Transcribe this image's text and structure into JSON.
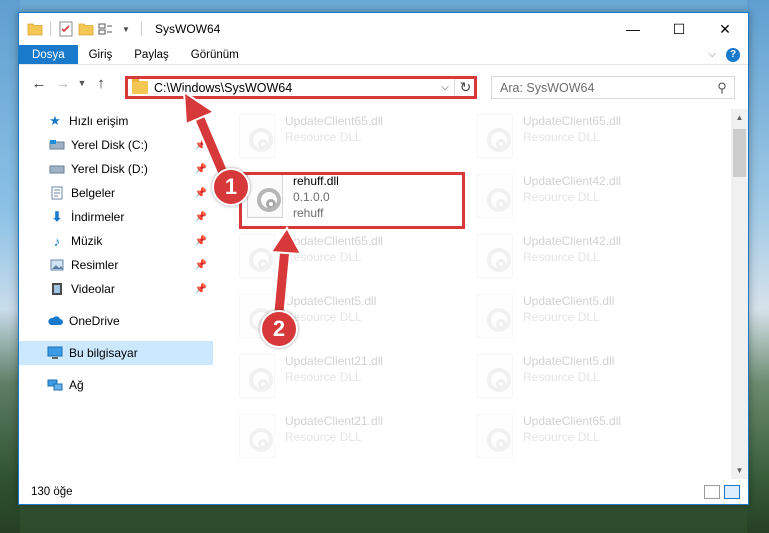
{
  "window": {
    "title": "SysWOW64",
    "controls": {
      "minimize": "—",
      "maximize": "☐",
      "close": "✕"
    }
  },
  "ribbon": {
    "tabs": [
      {
        "label": "Dosya",
        "active": true
      },
      {
        "label": "Giriş",
        "active": false
      },
      {
        "label": "Paylaş",
        "active": false
      },
      {
        "label": "Görünüm",
        "active": false
      }
    ]
  },
  "navigation": {
    "address": "C:\\Windows\\SysWOW64",
    "search_placeholder": "Ara: SysWOW64"
  },
  "sidebar": {
    "quick_access": "Hızlı erişim",
    "items": [
      {
        "label": "Yerel Disk (C:)",
        "icon": "drive-icon"
      },
      {
        "label": "Yerel Disk (D:)",
        "icon": "drive-icon"
      },
      {
        "label": "Belgeler",
        "icon": "documents-icon"
      },
      {
        "label": "İndirmeler",
        "icon": "downloads-icon"
      },
      {
        "label": "Müzik",
        "icon": "music-icon"
      },
      {
        "label": "Resimler",
        "icon": "pictures-icon"
      },
      {
        "label": "Videolar",
        "icon": "videos-icon"
      }
    ],
    "onedrive": "OneDrive",
    "this_pc": "Bu bilgisayar",
    "network": "Ağ"
  },
  "files": {
    "highlighted": {
      "name": "rehuff.dll",
      "version": "0.1.0.0",
      "description": "rehuff"
    },
    "background": [
      {
        "name": "UpdateClient65.dll",
        "description": "Resource DLL"
      },
      {
        "name": "UpdateClient65.dll",
        "description": "Resource DLL"
      },
      {
        "name": "UpdateClient42.dll",
        "description": "Resource DLL"
      },
      {
        "name": "UpdateClient65.dll",
        "description": "Resource DLL"
      },
      {
        "name": "UpdateClient42.dll",
        "description": "Resource DLL"
      },
      {
        "name": "UpdateClient5.dll",
        "description": "Resource DLL"
      },
      {
        "name": "UpdateClient5.dll",
        "description": "Resource DLL"
      },
      {
        "name": "UpdateClient21.dll",
        "description": "Resource DLL"
      },
      {
        "name": "UpdateClient5.dll",
        "description": "Resource DLL"
      },
      {
        "name": "UpdateClient21.dll",
        "description": "Resource DLL"
      },
      {
        "name": "UpdateClient65.dll",
        "description": "Resource DLL"
      }
    ]
  },
  "status": {
    "item_count": "130 öğe"
  },
  "annotations": [
    {
      "label": "1"
    },
    {
      "label": "2"
    }
  ],
  "colors": {
    "accent": "#1979ca",
    "highlight": "#d7383a",
    "selected": "#cce8ff"
  }
}
